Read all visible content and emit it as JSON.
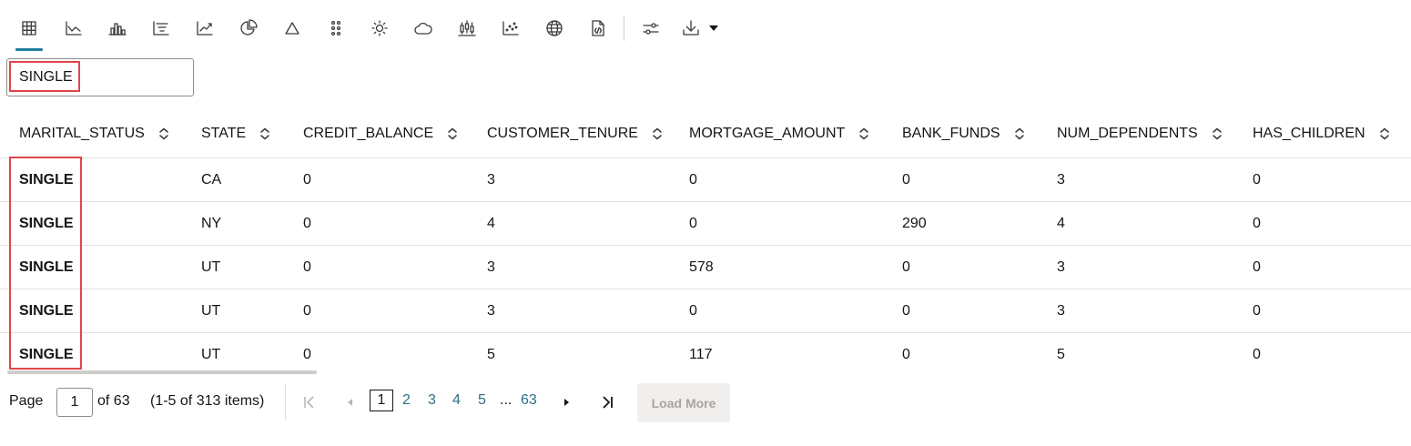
{
  "toolbar": {
    "icons": [
      "table-icon",
      "line-chart-icon",
      "bar-chart-icon",
      "funnel-icon",
      "trend-chart-icon",
      "pie-chart-icon",
      "triangle-icon",
      "dot-grid-icon",
      "sun-icon",
      "cloud-icon",
      "box-plot-icon",
      "scatter-chart-icon",
      "globe-icon",
      "code-file-icon",
      "settings-sliders-icon",
      "download-icon"
    ],
    "active": "table-icon"
  },
  "search": {
    "value": "SINGLE"
  },
  "table": {
    "columns": [
      "MARITAL_STATUS",
      "STATE",
      "CREDIT_BALANCE",
      "CUSTOMER_TENURE",
      "MORTGAGE_AMOUNT",
      "BANK_FUNDS",
      "NUM_DEPENDENTS",
      "HAS_CHILDREN"
    ],
    "rows": [
      [
        "SINGLE",
        "CA",
        "0",
        "3",
        "0",
        "0",
        "3",
        "0"
      ],
      [
        "SINGLE",
        "NY",
        "0",
        "4",
        "0",
        "290",
        "4",
        "0"
      ],
      [
        "SINGLE",
        "UT",
        "0",
        "3",
        "578",
        "0",
        "3",
        "0"
      ],
      [
        "SINGLE",
        "UT",
        "0",
        "3",
        "0",
        "0",
        "3",
        "0"
      ],
      [
        "SINGLE",
        "UT",
        "0",
        "5",
        "117",
        "0",
        "5",
        "0"
      ]
    ]
  },
  "pager": {
    "page_label": "Page",
    "current_page": "1",
    "of_label": "of 63",
    "items_label": "(1-5 of 313 items)",
    "pages": [
      "1",
      "2",
      "3",
      "4",
      "5",
      "63"
    ],
    "ellipsis": "...",
    "load_more": "Load More"
  },
  "colors": {
    "accent": "#227e9e",
    "highlight": "#e0464b",
    "link": "#2b6e85"
  }
}
